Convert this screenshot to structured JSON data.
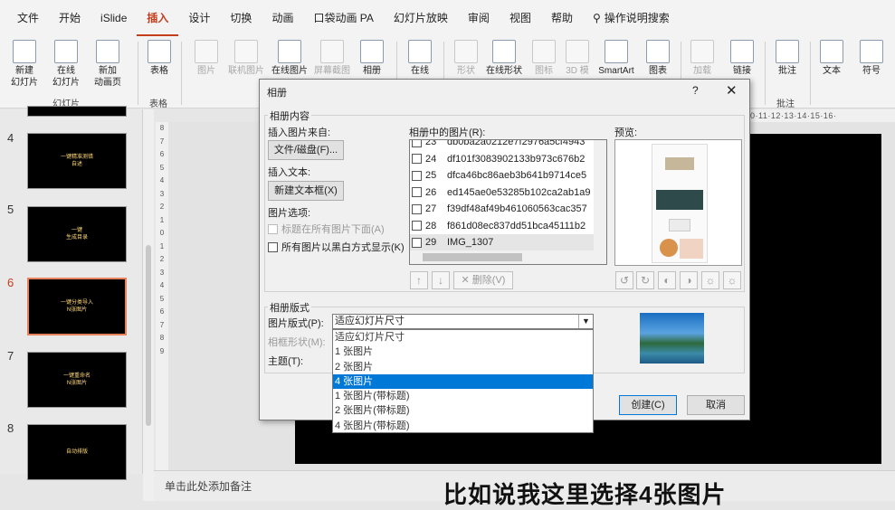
{
  "menubar": {
    "tabs": [
      "文件",
      "开始",
      "iSlide",
      "插入",
      "设计",
      "切换",
      "动画",
      "口袋动画 PA",
      "幻灯片放映",
      "审阅",
      "视图",
      "帮助"
    ],
    "active_tab": "插入",
    "tell_me": "操作说明搜索"
  },
  "ribbon": {
    "new_slide": "新建\n幻灯片",
    "online_slide": "在线\n幻灯片",
    "new_anim_page": "新加\n动画页",
    "group_slides": "幻灯片",
    "table": "表格",
    "group_table": "表格",
    "image": "图片",
    "online_image_dim": "联机图片",
    "online_image": "在线图片",
    "screenshot": "屏幕截图",
    "album": "相册",
    "online": "在线",
    "shapes": "形状",
    "online_shapes": "在线形状",
    "icons": "图标",
    "3d": "3D 模",
    "smartart": "SmartArt",
    "chart": "图表",
    "addin": "加载",
    "link": "链接",
    "comment": "批注",
    "group_comment": "批注",
    "text": "文本",
    "symbol": "符号"
  },
  "ruler_h": "·10·11·12·13·14·15·16·",
  "ruler_v": [
    "8",
    "7",
    "6",
    "5",
    "4",
    "3",
    "2",
    "1",
    "0",
    "1",
    "2",
    "3",
    "4",
    "5",
    "6",
    "7",
    "8",
    "9"
  ],
  "slides": [
    {
      "num": "4",
      "text": "一键精准测错\n自述"
    },
    {
      "num": "5",
      "text": "一键\n生成目录"
    },
    {
      "num": "6",
      "text": "一键分类导入\nN张图片"
    },
    {
      "num": "7",
      "text": "一键重命名\nN张图片"
    },
    {
      "num": "8",
      "text": "自动排版"
    }
  ],
  "notes_placeholder": "单击此处添加备注",
  "subtitle": "比如说我这里选择4张图片",
  "dialog": {
    "title": "相册",
    "help": "?",
    "close": "✕",
    "album_content": "相册内容",
    "insert_from": "插入图片来自:",
    "file_disk_btn": "文件/磁盘(F)...",
    "insert_text": "插入文本:",
    "new_textbox_btn": "新建文本框(X)",
    "image_options": "图片选项:",
    "captions_below": "标题在所有图片下面(A)",
    "black_white": "所有图片以黑白方式显示(K)",
    "album_images": "相册中的图片(R):",
    "preview": "预览:",
    "list": [
      {
        "num": "23",
        "name": "db0ba2a0212e7f2976a5cf4943"
      },
      {
        "num": "24",
        "name": "df101f3083902133b973c676b2"
      },
      {
        "num": "25",
        "name": "dfca46bc86aeb3b641b9714ce5"
      },
      {
        "num": "26",
        "name": "ed145ae0e53285b102ca2ab1a9"
      },
      {
        "num": "27",
        "name": "f39df48af49b461060563cac357"
      },
      {
        "num": "28",
        "name": "f861d08ec837dd51bca45111b2"
      },
      {
        "num": "29",
        "name": "IMG_1307"
      }
    ],
    "delete_btn": "删除(V)",
    "album_layout": "相册版式",
    "image_layout_label": "图片版式(P):",
    "image_layout_value": "适应幻灯片尺寸",
    "frame_shape_label": "相框形状(M):",
    "theme_label": "主题(T):",
    "dropdown_options": [
      "适应幻灯片尺寸",
      "1 张图片",
      "2 张图片",
      "4 张图片",
      "1 张图片(带标题)",
      "2 张图片(带标题)",
      "4 张图片(带标题)"
    ],
    "highlighted_option": "4 张图片",
    "create_btn": "创建(C)",
    "cancel_btn": "取消"
  }
}
